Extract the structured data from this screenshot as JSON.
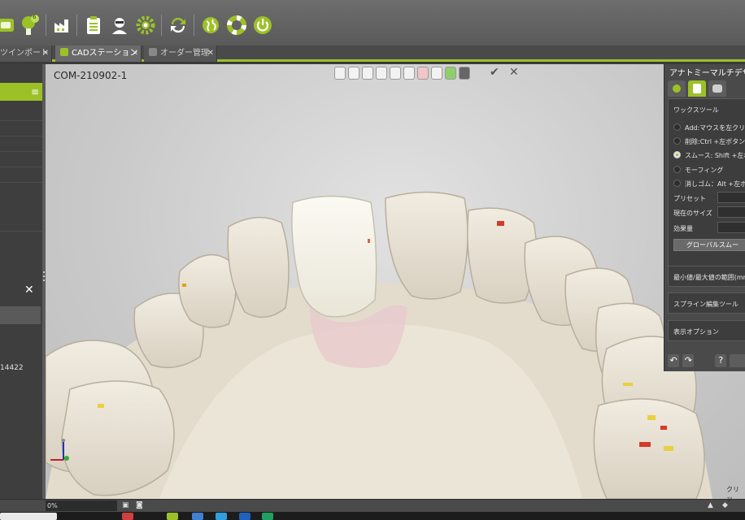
{
  "toolbar": {
    "icons": [
      "dental-scan-icon",
      "clinic-user-icon",
      "factory-icon",
      "clipboard-icon",
      "technician-icon",
      "settings-gear-icon",
      "sync-icon",
      "globe-icon",
      "lifebuoy-icon",
      "power-icon"
    ],
    "badge_count": "6"
  },
  "tabs": [
    {
      "label": "ツインポート",
      "active": false
    },
    {
      "label": "CADステーション",
      "active": true
    },
    {
      "label": "オーダー管理",
      "active": false
    }
  ],
  "left_panel": {
    "order_number_fragment": "14422"
  },
  "viewport": {
    "case_id": "COM-210902-1"
  },
  "right_panel": {
    "title": "アナトミーマルチデザ",
    "section_wax_tool": "ワックスツール",
    "wax_options": [
      {
        "label": "Add:マウスを左クリック",
        "selected": false
      },
      {
        "label": "削除:Ctrl +左ボタン",
        "selected": false
      },
      {
        "label": "スムース: Shift +左ボ",
        "selected": true
      },
      {
        "label": "モーフィング",
        "selected": false
      },
      {
        "label": "消しゴム：Alt +左ボタ",
        "selected": false
      }
    ],
    "preset_label": "プリセット",
    "current_size_label": "現在のサイズ",
    "effect_label": "効果量",
    "global_smooth_button": "グローバルスムー",
    "minmax_range_label": "最小値/最大値の範囲(mm)",
    "spline_edit_tool": "スプライン編集ツール",
    "display_options": "表示オプション"
  },
  "status": {
    "zoom_value": "0%",
    "clip_label": "クリッ"
  },
  "colors": {
    "accent": "#9cc128",
    "tooth_base": "#ece6d8",
    "crown_white": "#f6f4ea",
    "gingiva_overlay": "#e8c8cc"
  }
}
